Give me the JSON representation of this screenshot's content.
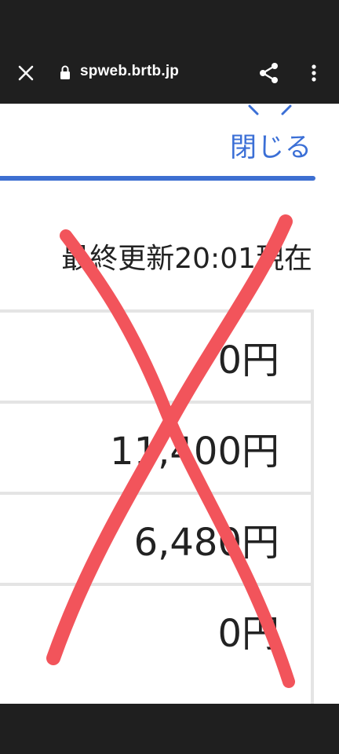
{
  "browser": {
    "url": "spweb.brtb.jp",
    "icons": [
      "close-icon",
      "lock-icon",
      "share-icon",
      "more-vert-icon"
    ]
  },
  "page": {
    "close_label": "閉じる",
    "last_updated": "最終更新20:01現在",
    "amounts": [
      "0円",
      "11,400円",
      "6,480円",
      "0円"
    ]
  },
  "colors": {
    "chrome": "#1f1f1f",
    "accent": "#3b6fd6",
    "cross_mark": "#f2545b"
  }
}
